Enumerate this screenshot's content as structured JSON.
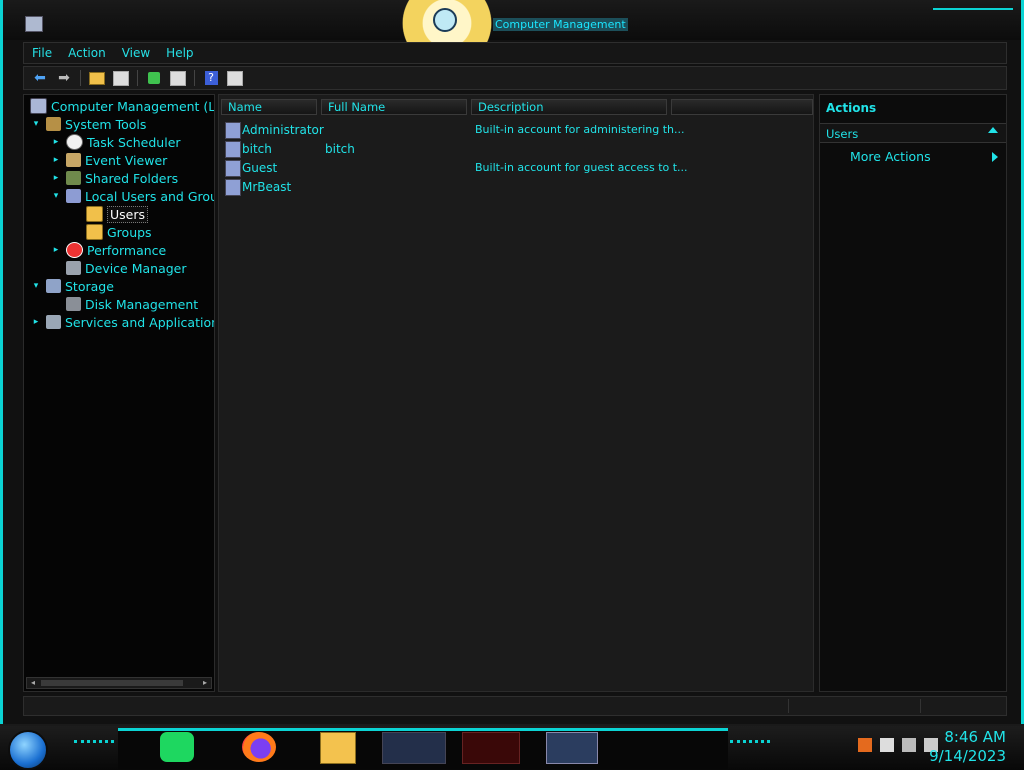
{
  "window": {
    "title": "Computer Management"
  },
  "menu": [
    "File",
    "Action",
    "View",
    "Help"
  ],
  "toolbar": {
    "icons": [
      "back-arrow-icon",
      "forward-arrow-icon",
      "up-folder-icon",
      "show-hide-tree-icon",
      "refresh-icon",
      "export-list-icon",
      "help-icon",
      "show-hide-action-pane-icon"
    ]
  },
  "tree": {
    "items": [
      {
        "label": "Computer Management (Loc",
        "level": 0,
        "expander": "",
        "icon": "computer-icon"
      },
      {
        "label": "System Tools",
        "level": 1,
        "expander": "▾",
        "icon": "tools-icon"
      },
      {
        "label": "Task Scheduler",
        "level": 2,
        "expander": "▸",
        "icon": "clock-icon"
      },
      {
        "label": "Event Viewer",
        "level": 2,
        "expander": "▸",
        "icon": "event-viewer-icon"
      },
      {
        "label": "Shared Folders",
        "level": 2,
        "expander": "▸",
        "icon": "shared-folder-icon"
      },
      {
        "label": "Local Users and Grou",
        "level": 2,
        "expander": "▾",
        "icon": "users-group-icon"
      },
      {
        "label": "Users",
        "level": 3,
        "expander": "",
        "icon": "folder-icon",
        "selected": true
      },
      {
        "label": "Groups",
        "level": 3,
        "expander": "",
        "icon": "folder-icon"
      },
      {
        "label": "Performance",
        "level": 2,
        "expander": "▸",
        "icon": "performance-icon"
      },
      {
        "label": "Device Manager",
        "level": 2,
        "expander": "",
        "icon": "device-manager-icon"
      },
      {
        "label": "Storage",
        "level": 1,
        "expander": "▾",
        "icon": "storage-icon"
      },
      {
        "label": "Disk Management",
        "level": 2,
        "expander": "",
        "icon": "disk-icon"
      },
      {
        "label": "Services and Applications",
        "level": 1,
        "expander": "▸",
        "icon": "services-icon"
      }
    ]
  },
  "list": {
    "columns": [
      "Name",
      "Full Name",
      "Description"
    ],
    "rows": [
      {
        "name": "Administrator",
        "full_name": "",
        "description": "Built-in account for administering th..."
      },
      {
        "name": "bitch",
        "full_name": "bitch",
        "description": ""
      },
      {
        "name": "Guest",
        "full_name": "",
        "description": "Built-in account for guest access to t..."
      },
      {
        "name": "MrBeast",
        "full_name": "",
        "description": ""
      }
    ]
  },
  "actions": {
    "title": "Actions",
    "section": "Users",
    "more": "More Actions"
  },
  "taskbar": {
    "apps": [
      "spotify-icon",
      "firefox-icon",
      "file-explorer-icon",
      "card-app-icon",
      "red-app-icon",
      "computer-management-icon"
    ],
    "tray": [
      "java-icon",
      "flag-icon",
      "network-icon",
      "volume-icon"
    ],
    "time": "8:46 AM",
    "date": "9/14/2023"
  },
  "colors": {
    "accent": "#21e3e8",
    "frame": "#0bd3d3",
    "background": "#111111"
  }
}
